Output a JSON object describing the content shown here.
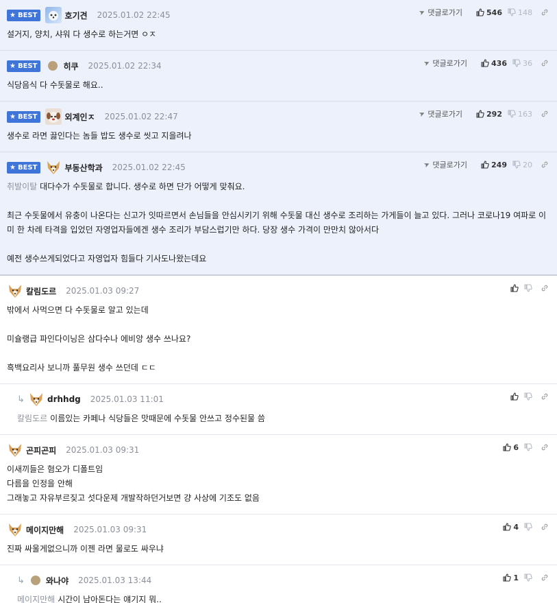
{
  "best_label": "BEST",
  "reply_link_label": "댓글로가기",
  "comments": [
    {
      "nick": "호기견",
      "date": "2025.01.02 22:45",
      "likes": "546",
      "dislikes": "148",
      "lines": [
        "설거지, 양치, 샤워 다 생수로 하는거면 ㅇㅈ"
      ]
    },
    {
      "nick": "히쿠",
      "date": "2025.01.02 22:34",
      "likes": "436",
      "dislikes": "36",
      "lines": [
        "식당음식 다 수돗물로 해요.."
      ]
    },
    {
      "nick": "외계인ㅈ",
      "date": "2025.01.02 22:47",
      "likes": "292",
      "dislikes": "163",
      "lines": [
        "생수로 라면 끓인다는 놈들 밥도 생수로 씻고 지을려나"
      ]
    },
    {
      "nick": "부동산학과",
      "date": "2025.01.02 22:45",
      "likes": "249",
      "dislikes": "20",
      "mention": "취발이탈",
      "lines": [
        "대다수가 수돗물로 합니다. 생수로 하면 단가 어떻게 맞춰요.",
        "",
        "최근 수돗물에서 유충이 나온다는 신고가 잇따르면서 손님들을 안심시키기 위해 수돗물 대신 생수로 조리하는 가게들이 늘고 있다. 그러나 코로나19 여파로 이",
        "미 한 차례 타격을 입었던 자영업자들에겐 생수 조리가 부담스럽기만 하다. 당장 생수 가격이 만만치 않아서다",
        "",
        "예전 생수쓰게되었다고 자영업자 힘들다 기사도나왔는데요"
      ]
    },
    {
      "nick": "칼림도르",
      "date": "2025.01.03 09:27",
      "lines": [
        "밖에서 사먹으면 다 수돗물로 알고 있는데",
        "",
        "미슐랭급 파인다이닝은 삼다수나 에비앙 생수 쓰나요?",
        "",
        "흑백요리사 보니까 풀무원 생수 쓰던데 ㄷㄷ"
      ]
    },
    {
      "nick": "drhhdg",
      "date": "2025.01.03 11:01",
      "mention": "칼림도르",
      "lines": [
        "이름있는 카페나 식당들은 맛때문에 수돗물 안쓰고 정수된물 씀"
      ]
    },
    {
      "nick": "곤피곤피",
      "date": "2025.01.03 09:31",
      "likes": "6",
      "lines": [
        "이새끼들은 혐오가 디폴트임",
        "다름을 인정을 안해",
        "그래놓고 자유부르짖고 섯다운제 개발작하던거보면 걍 사상에 기조도 없음"
      ]
    },
    {
      "nick": "메이지만해",
      "date": "2025.01.03 09:31",
      "likes": "4",
      "lines": [
        "진짜 싸울게없으니까 이젠 라면 물로도 싸우냐"
      ]
    },
    {
      "nick": "와나야",
      "date": "2025.01.03 13:44",
      "likes": "1",
      "mention": "메이지만해",
      "lines": [
        "시간이 남아돈다는 얘기지 뭐.."
      ]
    }
  ]
}
